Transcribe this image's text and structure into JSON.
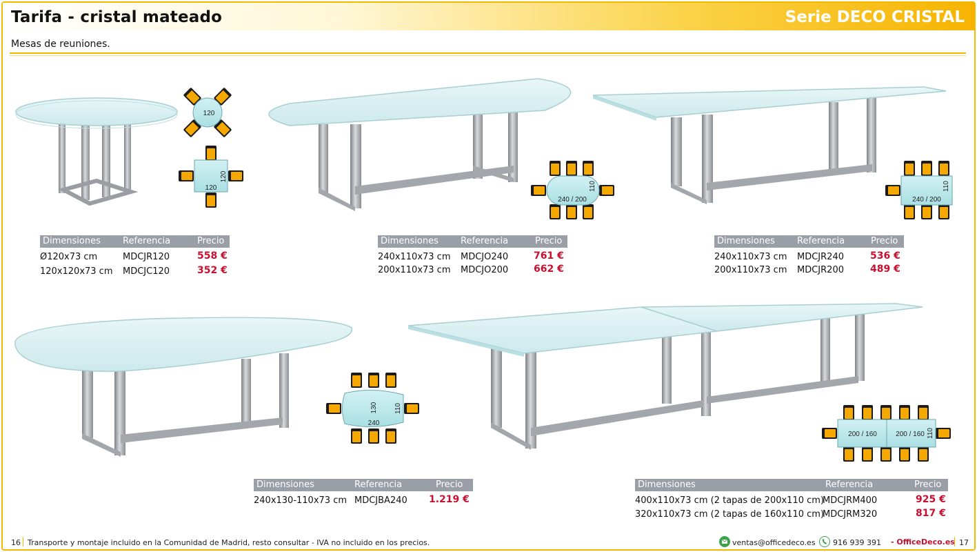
{
  "header": {
    "title": "Tarifa - cristal mateado",
    "series": "Serie DECO CRISTAL"
  },
  "subtitle": "Mesas de reuniones.",
  "table_headers": {
    "dim": "Dimensiones",
    "ref": "Referencia",
    "price": "Precio"
  },
  "plans": {
    "round": "120",
    "square_w": "120",
    "square_h": "120",
    "oval_len": "240 / 200",
    "oval_w": "110",
    "rect_len": "240 / 200",
    "rect_w": "110",
    "boat_len": "240",
    "boat_w1": "130",
    "boat_w2": "110",
    "double_a": "200 / 160",
    "double_b": "200 / 160",
    "double_w": "110"
  },
  "tables": {
    "round": [
      {
        "dim": "Ø120x73 cm",
        "ref": "MDCJR120",
        "price": "558 €"
      },
      {
        "dim": "120x120x73 cm",
        "ref": "MDCJC120",
        "price": "352 €"
      }
    ],
    "oval": [
      {
        "dim": "240x110x73 cm",
        "ref": "MDCJO240",
        "price": "761 €"
      },
      {
        "dim": "200x110x73 cm",
        "ref": "MDCJO200",
        "price": "662 €"
      }
    ],
    "rect": [
      {
        "dim": "240x110x73 cm",
        "ref": "MDCJR240",
        "price": "536 €"
      },
      {
        "dim": "200x110x73 cm",
        "ref": "MDCJR200",
        "price": "489 €"
      }
    ],
    "boat": [
      {
        "dim": "240x130-110x73 cm",
        "ref": "MDCJBA240",
        "price": "1.219 €"
      }
    ],
    "double": [
      {
        "dim": "400x110x73 cm (2 tapas de 200x110 cm)",
        "ref": "MDCJRM400",
        "price": "925 €"
      },
      {
        "dim": "320x110x73 cm (2 tapas de 160x110 cm)",
        "ref": "MDCJRM320",
        "price": "817 €"
      }
    ]
  },
  "footer": {
    "page_left": "16",
    "note": "Transporte y montaje incluido en la Comunidad de Madrid, resto consultar - IVA no incluido en los precios.",
    "email": "ventas@officedeco.es",
    "phone": "916 939 391",
    "brand": "- OfficeDeco.es",
    "page_right": "17"
  },
  "colors": {
    "accent": "#f5b800",
    "price": "#c8102e",
    "glass": "#d6eef0",
    "chair": "#f5a800",
    "header_bar": "#9a9ea6"
  }
}
